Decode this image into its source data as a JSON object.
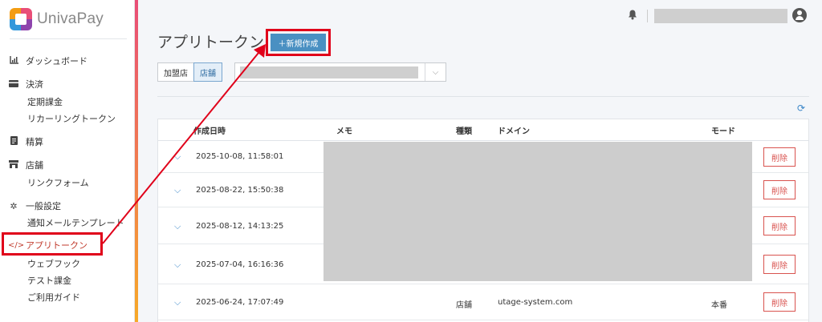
{
  "brand": {
    "name": "UnivaPay"
  },
  "sidebar": {
    "items": [
      {
        "label": "ダッシュボード",
        "icon": "chart-icon"
      },
      {
        "label": "決済",
        "icon": "card-icon"
      },
      {
        "label": "定期課金"
      },
      {
        "label": "リカーリングトークン"
      },
      {
        "label": "精算",
        "icon": "document-icon"
      },
      {
        "label": "店舗",
        "icon": "store-icon"
      },
      {
        "label": "リンクフォーム"
      },
      {
        "label": "一般設定",
        "icon": "gear-icon"
      },
      {
        "label": "通知メールテンプレート"
      },
      {
        "label": "アプリトークン",
        "icon": "code-icon",
        "active": true
      },
      {
        "label": "ウェブフック"
      },
      {
        "label": "テスト課金"
      },
      {
        "label": "ご利用ガイド"
      }
    ]
  },
  "header": {
    "notifications_icon": "bell-icon",
    "account_icon": "user-circle-icon"
  },
  "main": {
    "title": "アプリトークン",
    "new_button": "＋新規作成",
    "filter": {
      "merchant_label": "加盟店",
      "store_label": "店舗",
      "selected": "店舗"
    },
    "refresh_icon": "refresh-icon"
  },
  "table": {
    "columns": {
      "created": "作成日時",
      "memo": "メモ",
      "type": "種類",
      "domain": "ドメイン",
      "mode": "モード"
    },
    "delete_label": "削除",
    "rows": [
      {
        "created": "2025-10-08, 11:58:01",
        "type": "",
        "domain": "",
        "mode": ""
      },
      {
        "created": "2025-08-22, 15:50:38",
        "type": "",
        "domain": "",
        "mode": ""
      },
      {
        "created": "2025-08-12, 14:13:25",
        "type": "",
        "domain": "",
        "mode": ""
      },
      {
        "created": "2025-07-04, 16:16:36",
        "type": "",
        "domain": "",
        "mode": ""
      },
      {
        "created": "2025-06-24, 17:07:49",
        "type": "店舗",
        "domain": "utage-system.com",
        "mode": "本番"
      }
    ]
  },
  "colors": {
    "accent": "#4a90c2",
    "highlight": "#e0001a",
    "danger": "#d9534f",
    "active_nav": "#c0392b"
  }
}
